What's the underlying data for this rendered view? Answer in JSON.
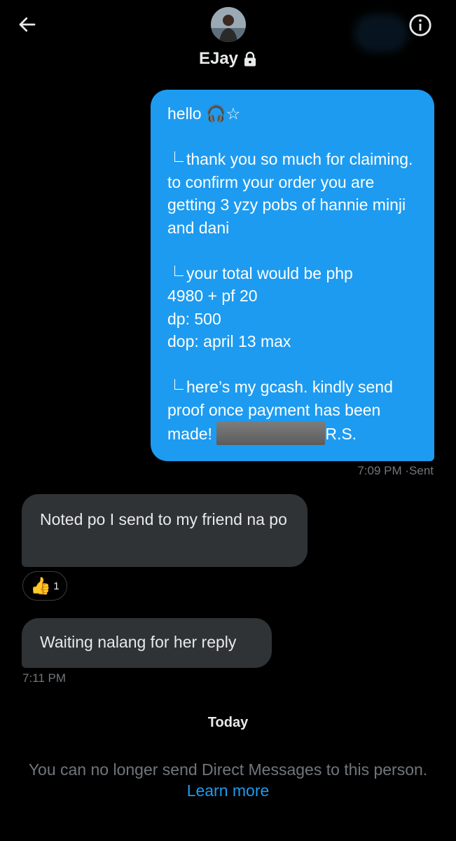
{
  "header": {
    "name": "EJay",
    "back_icon": "arrow-left-icon",
    "info_icon": "info-circle-icon",
    "lock_icon": "lock-icon"
  },
  "messages": {
    "sent": {
      "line1": "hello 🎧☆",
      "para2": "thank you so much for claiming. to confirm your order you are getting 3 yzy pobs of hannie minji and dani",
      "para3_l1": "your total would be php",
      "para3_l2": "4980 + pf 20",
      "para3_l3": "dp: 500",
      "para3_l4": "dop: april 13 max",
      "para4_l1": "here’s my gcash. kindly send",
      "para4_l2": "proof once payment has been",
      "para4_l3a": "made!",
      "para4_l3b": "R.S.",
      "time": "7:09 PM",
      "status": "·Sent"
    },
    "received1": {
      "text": "Noted po I send to my friend na po",
      "reaction_emoji": "👍",
      "reaction_count": "1"
    },
    "received2": {
      "text": "Waiting nalang for her reply",
      "time": "7:11 PM"
    }
  },
  "footer": {
    "day_label": "Today",
    "notice": "You can no longer send Direct Messages to this person.",
    "learn_more": "Learn more"
  },
  "colors": {
    "background": "#000000",
    "accent": "#1d9bf0",
    "received_bubble": "#2f3336",
    "muted": "#71767b"
  }
}
